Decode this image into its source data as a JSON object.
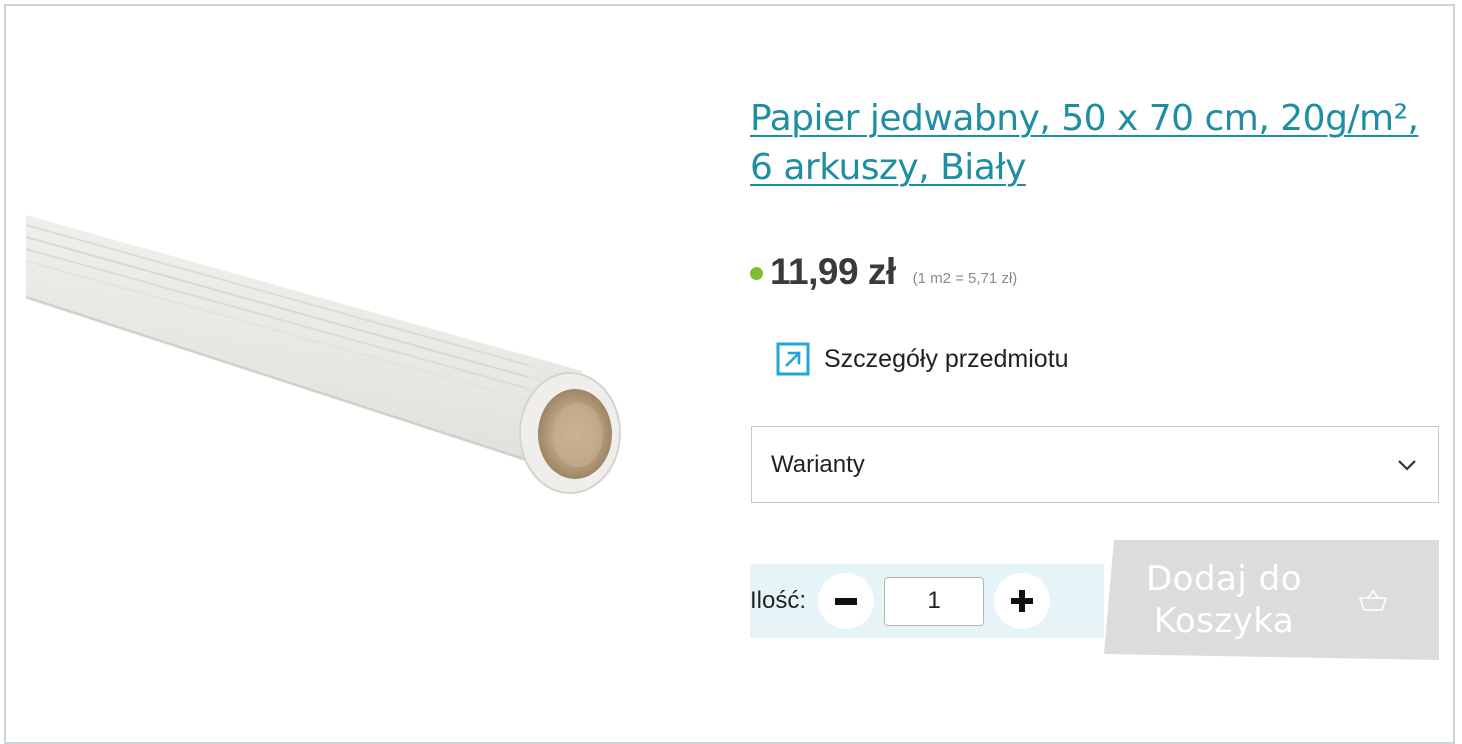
{
  "product": {
    "title": "Papier jedwabny, 50 x 70 cm, 20g/m², 6 arkuszy, Biały",
    "price": "11,99 zł",
    "unit_price": "(1 m2 = 5,71 zł)",
    "stock_color": "#7cbf31",
    "image_icon": "paper-roll-image"
  },
  "details_link": {
    "label": "Szczegóły przedmiotu",
    "icon": "external-link-icon"
  },
  "variants": {
    "selected": "Warianty",
    "icon": "chevron-down-icon"
  },
  "quantity": {
    "label": "Ilość:",
    "value": "1",
    "decrease_icon": "minus-icon",
    "increase_icon": "plus-icon"
  },
  "cart": {
    "line1": "Dodaj do",
    "line2": "Koszyka",
    "icon": "basket-icon"
  },
  "colors": {
    "accent": "#1e8fa2",
    "link_icon": "#1fa8d6",
    "qty_band": "#e6f4f8",
    "cart_disabled": "#dcdcdc"
  }
}
